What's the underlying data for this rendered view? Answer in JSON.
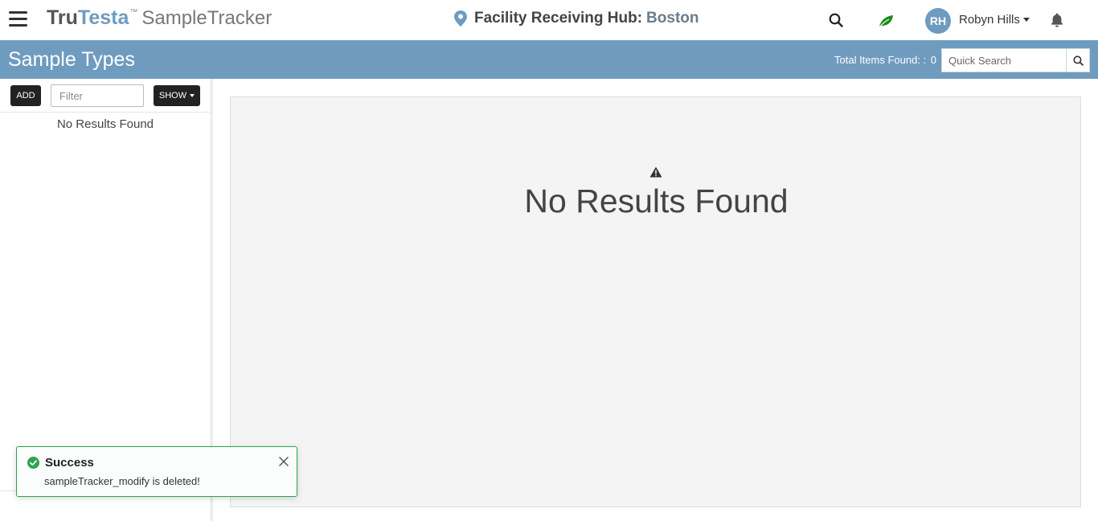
{
  "topbar": {
    "brand_tru": "Tru",
    "brand_testa": "Testa",
    "brand_tm": "™",
    "brand_app": "SampleTracker",
    "location_label": "Facility Receiving Hub:",
    "location_city": "Boston",
    "user_initials": "RH",
    "user_name": "Robyn Hills",
    "icons": [
      "hamburger-icon",
      "location-pin-icon",
      "search-icon",
      "leaf-icon",
      "bell-icon"
    ]
  },
  "header": {
    "title": "Sample Types",
    "total_label": "Total Items Found: :",
    "total_count": "0",
    "quick_search_placeholder": "Quick Search"
  },
  "sidebar": {
    "add_label": "ADD",
    "filter_placeholder": "Filter",
    "show_label": "SHOW",
    "empty_text": "No Results Found"
  },
  "main": {
    "empty_text": "No Results Found"
  },
  "toast": {
    "title": "Success",
    "message": "sampleTracker_modify is deleted!"
  },
  "colors": {
    "brand_blue": "#6f9bbf",
    "success_green": "#2ea44f",
    "leaf_green": "#1b8a1b",
    "dark_button": "#222222"
  }
}
